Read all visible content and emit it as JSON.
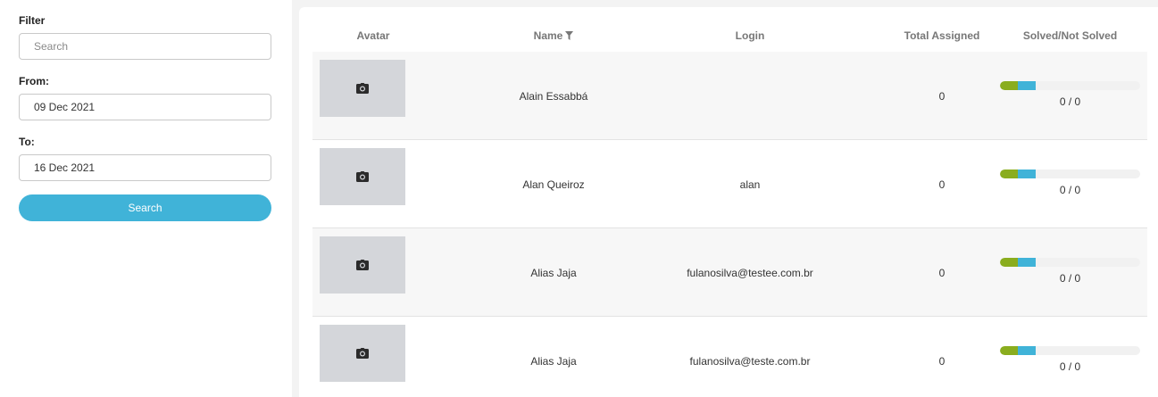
{
  "filter": {
    "title": "Filter",
    "search_placeholder": "Search",
    "from_label": "From:",
    "from_value": "09 Dec 2021",
    "to_label": "To:",
    "to_value": "16 Dec 2021",
    "search_button": "Search"
  },
  "table": {
    "columns": [
      "Avatar",
      "Name",
      "Login",
      "Total Assigned",
      "Solved/Not Solved"
    ],
    "rows": [
      {
        "name": "Alain Essabbá",
        "login": "",
        "total": "0",
        "ratio": "0 / 0",
        "solved_fraction": 0.13,
        "not_solved_fraction": 0.13
      },
      {
        "name": "Alan Queiroz",
        "login": "alan",
        "total": "0",
        "ratio": "0 / 0",
        "solved_fraction": 0.13,
        "not_solved_fraction": 0.13
      },
      {
        "name": "Alias Jaja",
        "login": "fulanosilva@testee.com.br",
        "total": "0",
        "ratio": "0 / 0",
        "solved_fraction": 0.13,
        "not_solved_fraction": 0.13
      },
      {
        "name": "Alias Jaja",
        "login": "fulanosilva@teste.com.br",
        "total": "0",
        "ratio": "0 / 0",
        "solved_fraction": 0.13,
        "not_solved_fraction": 0.13
      }
    ]
  },
  "colors": {
    "accent": "#40b3d8",
    "solved": "#8aad1e",
    "not_solved": "#40b3d8",
    "avatar_placeholder": "#d4d6da"
  },
  "icons": {
    "filter": "filter-icon",
    "avatar": "camera-icon"
  }
}
